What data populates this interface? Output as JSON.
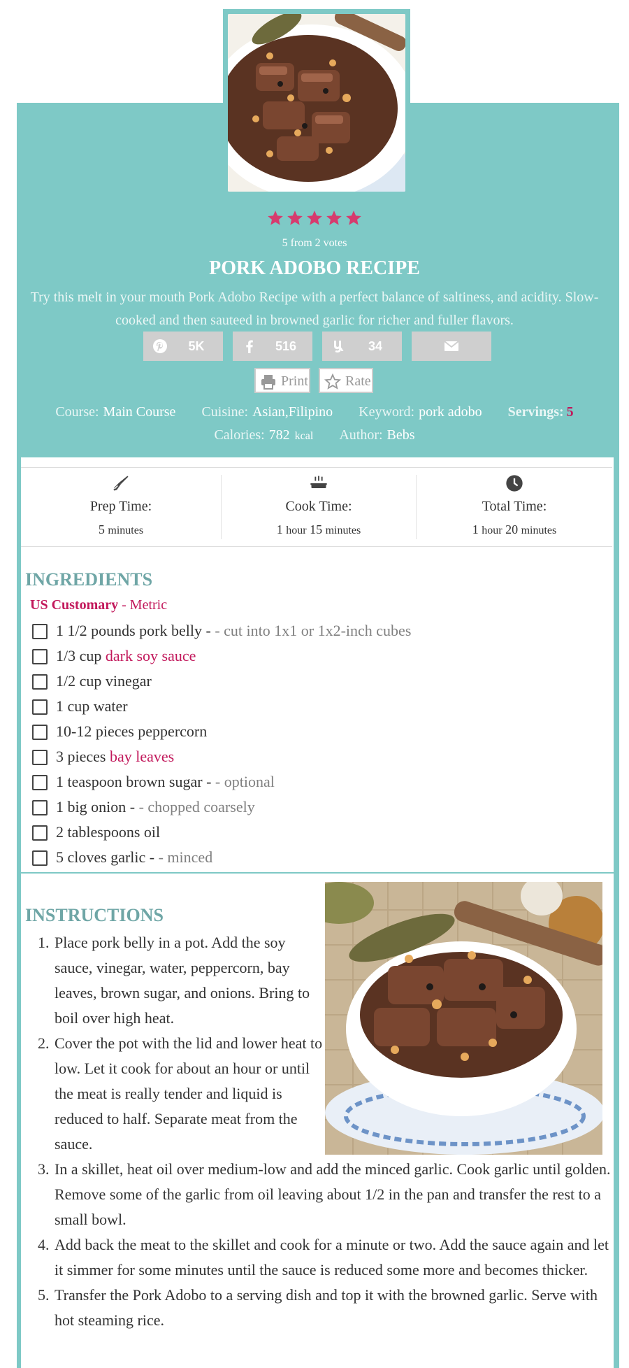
{
  "recipe": {
    "rating_text": "5 from 2 votes",
    "title": "PORK ADOBO RECIPE",
    "summary": "Try this melt in your mouth Pork Adobo Recipe with a perfect balance of saltiness, and acidity. Slow-cooked and then sauteed in browned garlic for richer and fuller flavors.",
    "rating_value": 5,
    "rating_max": 5
  },
  "share": {
    "pinterest": "5K",
    "facebook": "516",
    "yummly": "34"
  },
  "actions": {
    "print": "Print",
    "rate": "Rate"
  },
  "meta": {
    "course_label": "Course:",
    "course": "Main Course",
    "cuisine_label": "Cuisine:",
    "cuisine": "Asian,Filipino",
    "keyword_label": "Keyword:",
    "keyword": "pork adobo",
    "servings_label": "Servings:",
    "servings": "5",
    "calories_label": "Calories:",
    "calories": "782",
    "calories_unit": "kcal",
    "author_label": "Author:",
    "author": "Bebs"
  },
  "times": {
    "prep_label": "Prep Time:",
    "prep_value": "5",
    "prep_unit": "minutes",
    "cook_label": "Cook Time:",
    "cook_h": "1",
    "cook_h_unit": "hour",
    "cook_m": "15",
    "cook_m_unit": "minutes",
    "total_label": "Total Time:",
    "total_h": "1",
    "total_h_unit": "hour",
    "total_m": "20",
    "total_m_unit": "minutes"
  },
  "ingredients": {
    "heading": "INGREDIENTS",
    "units_active": "US Customary",
    "units_sep": " - ",
    "units_other": "Metric",
    "items": [
      {
        "text": "1 1/2 pounds pork belly - ",
        "link": "",
        "note": "- cut into 1x1 or 1x2-inch cubes"
      },
      {
        "text": "1/3 cup ",
        "link": "dark soy sauce",
        "note": ""
      },
      {
        "text": "1/2 cup vinegar",
        "link": "",
        "note": ""
      },
      {
        "text": "1 cup water",
        "link": "",
        "note": ""
      },
      {
        "text": "10-12 pieces peppercorn",
        "link": "",
        "note": ""
      },
      {
        "text": "3 pieces ",
        "link": "bay leaves",
        "note": ""
      },
      {
        "text": "1 teaspoon brown sugar - ",
        "link": "",
        "note": "- optional"
      },
      {
        "text": "1 big onion - ",
        "link": "",
        "note": "- chopped coarsely"
      },
      {
        "text": "2 tablespoons oil",
        "link": "",
        "note": ""
      },
      {
        "text": "5 cloves garlic - ",
        "link": "",
        "note": "- minced"
      }
    ]
  },
  "instructions": {
    "heading": "INSTRUCTIONS",
    "steps": [
      "Place pork belly in a pot. Add the soy sauce, vinegar, water, peppercorn, bay leaves, brown sugar, and onions. Bring to boil over high heat.",
      "Cover the pot with the lid and lower heat to low. Let it cook for about an hour or until the meat is really tender and liquid is reduced to half. Separate meat from the sauce.",
      "In a skillet, heat oil over medium-low and add the minced garlic. Cook garlic until golden. Remove some of the garlic from oil leaving about 1/2 in the pan and transfer the rest to a small bowl.",
      "Add back the meat to the skillet and cook for a minute or two. Add the sauce again and let it simmer for some minutes until the sauce is reduced some more and becomes thicker.",
      "Transfer the Pork Adobo to a serving dish and top it with the browned garlic. Serve with hot steaming rice."
    ]
  },
  "colors": {
    "accent": "#7ec9c6",
    "link": "#c2185b",
    "heading": "#6fa6a6"
  }
}
